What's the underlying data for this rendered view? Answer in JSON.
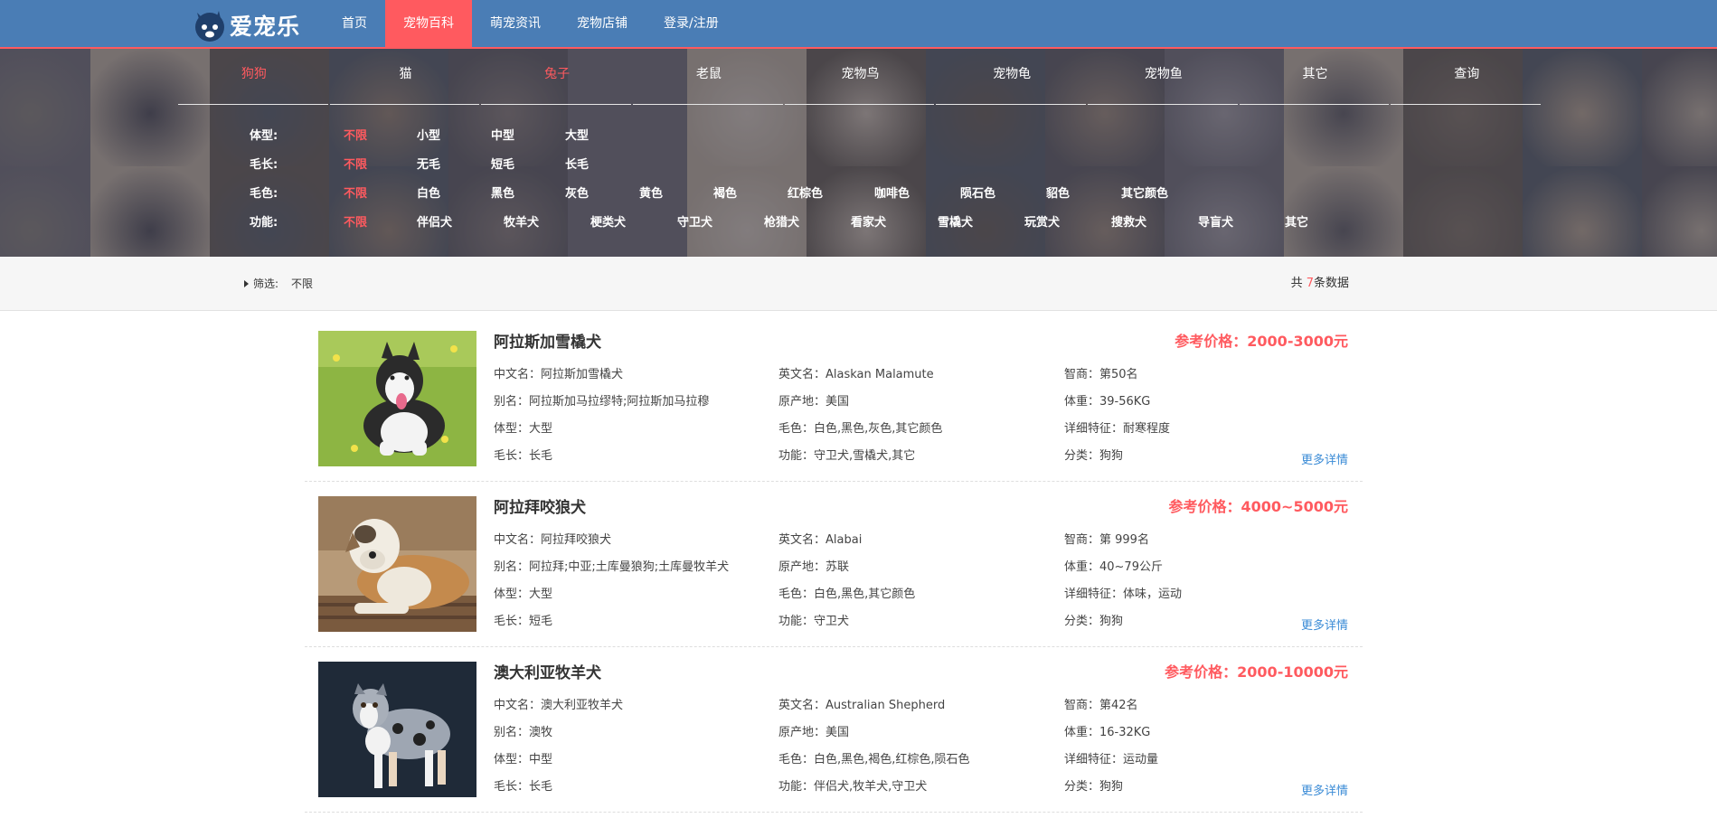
{
  "brand": {
    "logo_text": "爱宠乐",
    "logo_icon": "pet-head-logo"
  },
  "nav": [
    {
      "label": "首页"
    },
    {
      "label": "宠物百科",
      "active": true
    },
    {
      "label": "萌宠资讯"
    },
    {
      "label": "宠物店铺"
    },
    {
      "label": "登录/注册"
    }
  ],
  "categories": [
    "狗狗",
    "猫",
    "兔子",
    "老鼠",
    "宠物鸟",
    "宠物龟",
    "宠物鱼",
    "其它",
    "查询"
  ],
  "filters": {
    "body": {
      "label": "体型:",
      "options": [
        "不限",
        "小型",
        "中型",
        "大型"
      ]
    },
    "coat": {
      "label": "毛长:",
      "options": [
        "不限",
        "无毛",
        "短毛",
        "长毛"
      ]
    },
    "color": {
      "label": "毛色:",
      "options": [
        "不限",
        "白色",
        "黑色",
        "灰色",
        "黄色",
        "褐色",
        "红棕色",
        "咖啡色",
        "陨石色",
        "貂色",
        "其它颜色"
      ]
    },
    "function": {
      "label": "功能:",
      "options": [
        "不限",
        "伴侣犬",
        "牧羊犬",
        "梗类犬",
        "守卫犬",
        "枪猎犬",
        "看家犬",
        "雪橇犬",
        "玩赏犬",
        "搜救犬",
        "导盲犬",
        "其它"
      ]
    }
  },
  "summary": {
    "label": "筛选:",
    "value": "不限",
    "count_prefix": "共 ",
    "count": "7",
    "count_suffix": "条数据"
  },
  "pets": [
    {
      "name": "阿拉斯加雪橇犬",
      "price": "参考价格：2000-3000元",
      "col1": [
        "中文名：阿拉斯加雪橇犬",
        "别名：阿拉斯加马拉缪特;阿拉斯加马拉穆",
        "体型：大型",
        "毛长：长毛"
      ],
      "col2": [
        "英文名：Alaskan Malamute",
        "原产地：美国",
        "毛色：白色,黑色,灰色,其它颜色",
        "功能：守卫犬,雪橇犬,其它"
      ],
      "col3": [
        "智商：第50名",
        "体重：39-56KG",
        "详细特征：耐寒程度",
        "分类：狗狗"
      ],
      "more": "更多详情"
    },
    {
      "name": "阿拉拜咬狼犬",
      "price": "参考价格：4000~5000元",
      "col1": [
        "中文名：阿拉拜咬狼犬",
        "别名：阿拉拜;中亚;土库曼狼狗;土库曼牧羊犬",
        "体型：大型",
        "毛长：短毛"
      ],
      "col2": [
        "英文名：Alabai",
        "原产地：苏联",
        "毛色：白色,黑色,其它颜色",
        "功能：守卫犬"
      ],
      "col3": [
        "智商：第 999名",
        "体重：40~79公斤",
        "详细特征：体味，运动",
        "分类：狗狗"
      ],
      "more": "更多详情"
    },
    {
      "name": "澳大利亚牧羊犬",
      "price": "参考价格：2000-10000元",
      "col1": [
        "中文名：澳大利亚牧羊犬",
        "别名：澳牧",
        "体型：中型",
        "毛长：长毛"
      ],
      "col2": [
        "英文名：Australian Shepherd",
        "原产地：美国",
        "毛色：白色,黑色,褐色,红棕色,陨石色",
        "功能：伴侣犬,牧羊犬,守卫犬"
      ],
      "col3": [
        "智商：第42名",
        "体重：16-32KG",
        "详细特征：运动量",
        "分类：狗狗"
      ],
      "more": "更多详情"
    }
  ],
  "colors": {
    "nav_bg": "#4a7db5",
    "accent": "#ff5a5f",
    "link": "#3a8bd6"
  }
}
